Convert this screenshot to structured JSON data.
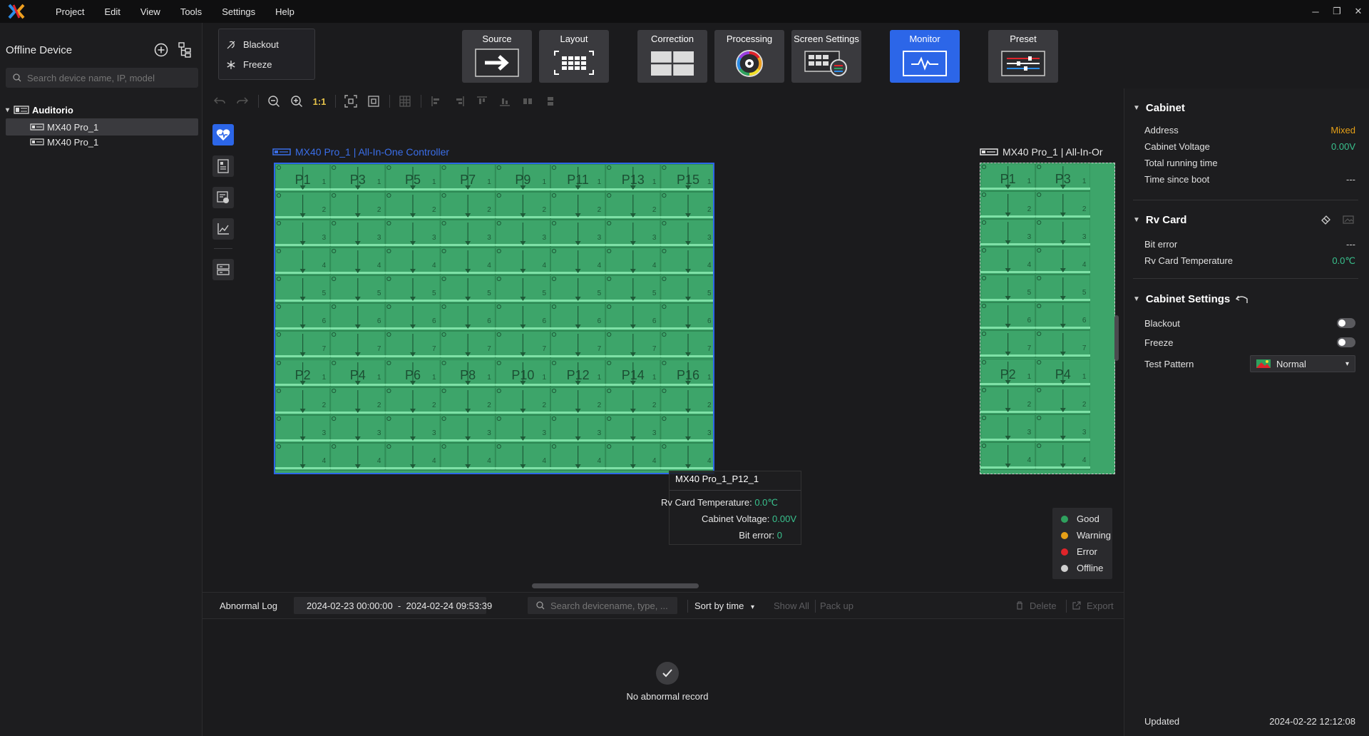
{
  "menu": [
    "Project",
    "Edit",
    "View",
    "Tools",
    "Settings",
    "Help"
  ],
  "sidebar": {
    "title": "Offline Device",
    "search_placeholder": "Search device name, IP, model",
    "group": "Auditorio",
    "devices": [
      "MX40 Pro_1",
      "MX40 Pro_1"
    ]
  },
  "quick": {
    "blackout": "Blackout",
    "freeze": "Freeze"
  },
  "tools": [
    {
      "label": "Source"
    },
    {
      "label": "Layout"
    },
    {
      "label": "Correction"
    },
    {
      "label": "Processing"
    },
    {
      "label": "Screen Settings"
    },
    {
      "label": "Monitor",
      "active": true
    },
    {
      "label": "Preset"
    }
  ],
  "zoom_label": "1:1",
  "screen1": {
    "title": "MX40 Pro_1 | All-In-One Controller",
    "top_ports": [
      "P1",
      "P3",
      "P5",
      "P7",
      "P9",
      "P11",
      "P13",
      "P15"
    ],
    "bottom_ports": [
      "P2",
      "P4",
      "P6",
      "P8",
      "P10",
      "P12",
      "P14",
      "P16"
    ],
    "top_rows": [
      "1",
      "2",
      "3",
      "4",
      "5",
      "6",
      "7"
    ],
    "bottom_rows": [
      "1",
      "2",
      "3",
      "4"
    ]
  },
  "screen2": {
    "title": "MX40 Pro_1 | All-In-Or",
    "top_ports": [
      "P1",
      "P3"
    ],
    "bottom_ports": [
      "P2",
      "P4"
    ]
  },
  "tooltip": {
    "title": "MX40 Pro_1_P12_1",
    "rv_temp_label": "Rv Card Temperature:",
    "rv_temp": "0.0℃",
    "voltage_label": "Cabinet Voltage:",
    "voltage": "0.00V",
    "bit_error_label": "Bit error:",
    "bit_error": "0"
  },
  "legend": [
    {
      "label": "Good",
      "color": "#2fa15e"
    },
    {
      "label": "Warning",
      "color": "#e6a017"
    },
    {
      "label": "Error",
      "color": "#e0242a"
    },
    {
      "label": "Offline",
      "color": "#d0d0d0"
    }
  ],
  "log": {
    "title": "Abnormal Log",
    "date_range": "2024-02-23 00:00:00  -  2024-02-24 09:53:39",
    "search_placeholder": "Search devicename, type, ...",
    "sort": "Sort by time",
    "show_all": "Show All",
    "pack_up": "Pack up",
    "delete": "Delete",
    "export": "Export",
    "empty": "No abnormal record"
  },
  "right_panel": {
    "cabinet": {
      "title": "Cabinet",
      "rows": [
        {
          "label": "Address",
          "value": "Mixed"
        },
        {
          "label": "Cabinet Voltage",
          "value": "0.00V"
        },
        {
          "label": "Total running time",
          "value": ""
        },
        {
          "label": "Time since boot",
          "value": "---"
        }
      ]
    },
    "rv_card": {
      "title": "Rv Card",
      "rows": [
        {
          "label": "Bit error",
          "value": "---"
        },
        {
          "label": "Rv Card Temperature",
          "value": "0.0℃"
        }
      ]
    },
    "cabinet_settings": {
      "title": "Cabinet Settings",
      "blackout": "Blackout",
      "freeze": "Freeze",
      "test_pattern_label": "Test Pattern",
      "test_pattern_value": "Normal"
    },
    "updated_label": "Updated",
    "updated_value": "2024-02-22 12:12:08"
  },
  "colors": {
    "accent": "#2c66e8",
    "panel_green": "#3da56a",
    "status_green": "#39c28e",
    "status_orange": "#e6a017"
  }
}
